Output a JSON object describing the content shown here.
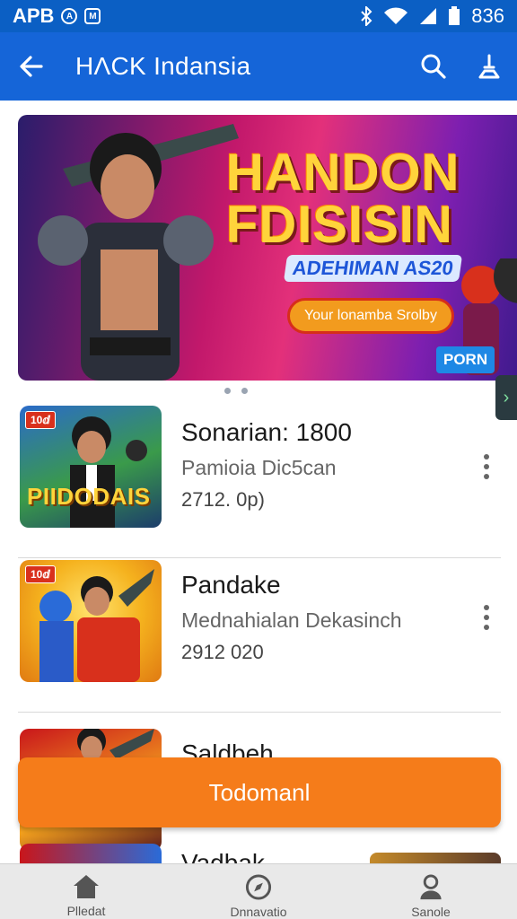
{
  "status_bar": {
    "carrier": "APB",
    "time": "836"
  },
  "app_bar": {
    "title": "HΛCK Indansia"
  },
  "banner": {
    "title_line1": "HANDON",
    "title_line2": "FDISISIN",
    "subtitle": "ADEHIMAN AS20",
    "pill": "Your lonamba Srolby",
    "tag": "PORN"
  },
  "list": {
    "items": [
      {
        "badge": "10ⅆ",
        "thumb_text": "PIIDODAIS",
        "title": "Sonarian: 1800",
        "subtitle": "Pamioia Dic5can",
        "meta": "2712. 0p)"
      },
      {
        "badge": "10ⅆ",
        "thumb_text": "",
        "title": "Pandake",
        "subtitle": "Mednahialan Dekasinch",
        "meta": "2912 020"
      },
      {
        "badge": "",
        "thumb_text": "",
        "title": "Saldbeh",
        "subtitle": "",
        "meta": ""
      }
    ],
    "peek_title": "Vadbak"
  },
  "cta": {
    "label": "Todomanl"
  },
  "bottom_nav": {
    "items": [
      {
        "label": "Plledat"
      },
      {
        "label": "Dnnavatio"
      },
      {
        "label": "Sanole"
      }
    ]
  },
  "colors": {
    "status_bar": "#0b5fc4",
    "app_bar": "#1565d8",
    "cta": "#f57c1a",
    "bottom_nav": "#e9e9e9"
  }
}
